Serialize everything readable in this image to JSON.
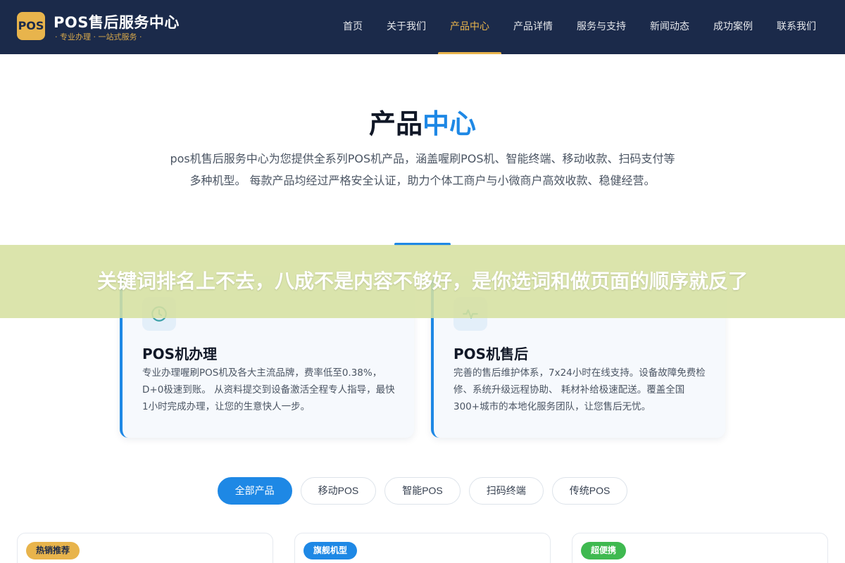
{
  "header": {
    "logo_text": "POS",
    "brand_title": "POS售后服务中心",
    "brand_subtitle": "· 专业办理 · 一站式服务 ·",
    "nav": [
      {
        "label": "首页",
        "active": false
      },
      {
        "label": "关于我们",
        "active": false
      },
      {
        "label": "产品中心",
        "active": true
      },
      {
        "label": "产品详情",
        "active": false
      },
      {
        "label": "服务与支持",
        "active": false
      },
      {
        "label": "新闻动态",
        "active": false
      },
      {
        "label": "成功案例",
        "active": false
      },
      {
        "label": "联系我们",
        "active": false
      }
    ]
  },
  "section": {
    "title_main": "产品",
    "title_highlight": "中心",
    "description": "pos机售后服务中心为您提供全系列POS机产品，涵盖喔刷POS机、智能终端、移动收款、扫码支付等多种机型。 每款产品均经过严格安全认证，助力个体工商户与小微商户高效收款、稳健经营。"
  },
  "banner": {
    "text": "关键词排名上不去，八成不是内容不够好，是你选词和做页面的顺序就反了"
  },
  "services": [
    {
      "icon": "clock-icon",
      "title": "POS机办理",
      "description": "专业办理喔刷POS机及各大主流品牌，费率低至0.38%，D+0极速到账。 从资料提交到设备激活全程专人指导，最快1小时完成办理，让您的生意快人一步。"
    },
    {
      "icon": "pulse-icon",
      "title": "POS机售后",
      "description": "完善的售后维护体系，7x24小时在线支持。设备故障免费检修、系统升级远程协助、 耗材补给极速配送。覆盖全国300+城市的本地化服务团队，让您售后无忧。"
    }
  ],
  "filters": [
    {
      "label": "全部产品",
      "active": true
    },
    {
      "label": "移动POS",
      "active": false
    },
    {
      "label": "智能POS",
      "active": false
    },
    {
      "label": "扫码终端",
      "active": false
    },
    {
      "label": "传统POS",
      "active": false
    }
  ],
  "products": [
    {
      "badge": "热销推荐"
    },
    {
      "badge": "旗舰机型"
    },
    {
      "badge": "超便携"
    }
  ],
  "colors": {
    "header_bg": "#1b2a4a",
    "accent_gold": "#e8b44c",
    "accent_blue": "#1e88e5",
    "badge_green": "#3fb950",
    "banner_bg": "#d6e0a0"
  }
}
